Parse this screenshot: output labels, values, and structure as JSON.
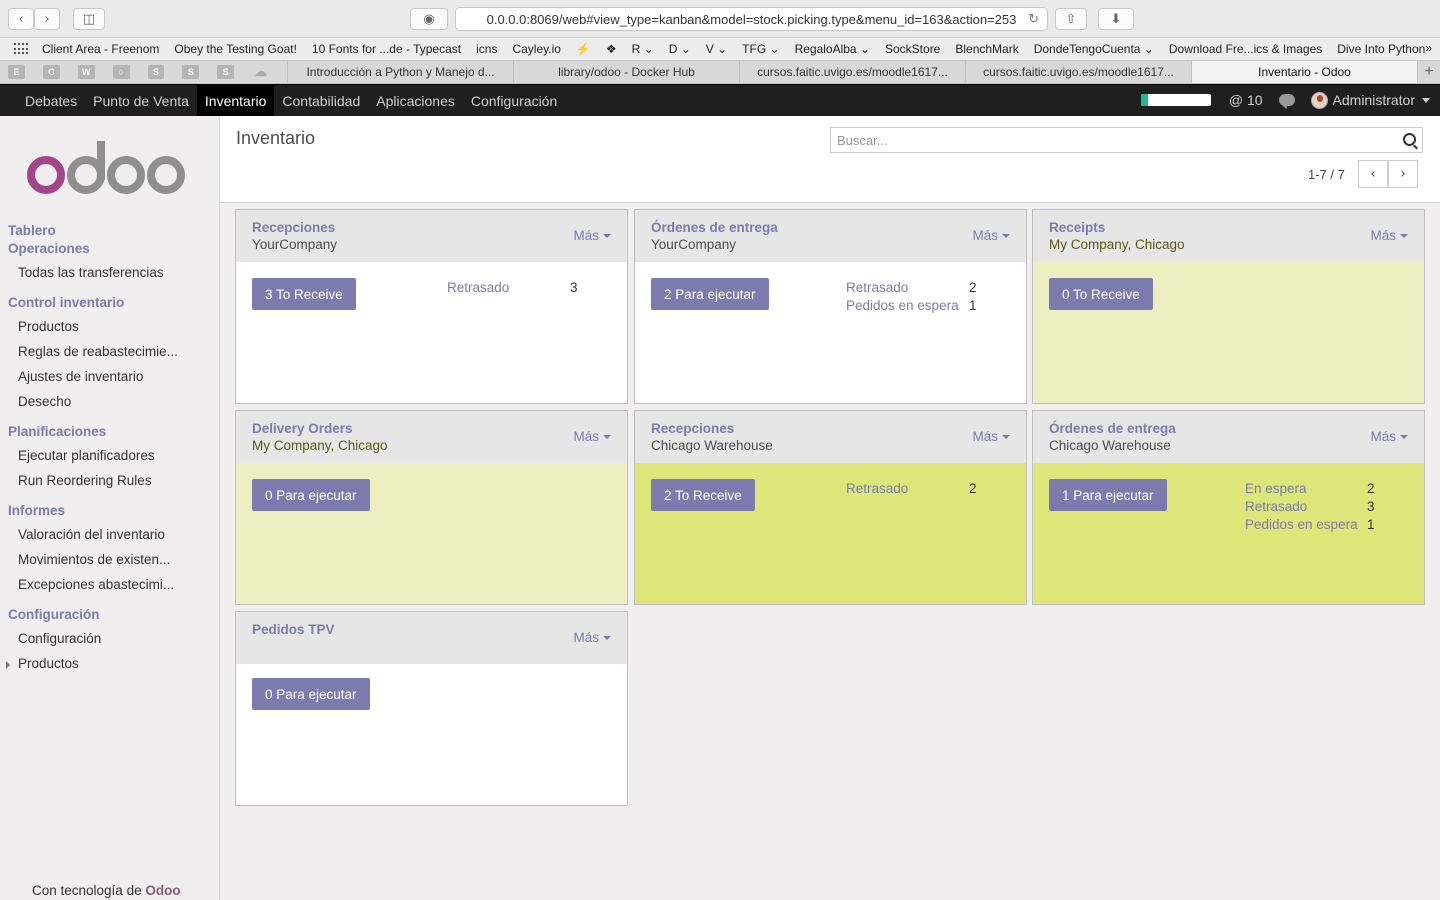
{
  "browser": {
    "url": "0.0.0.0:8069/web#view_type=kanban&model=stock.picking.type&menu_id=163&action=253",
    "bookmarks": [
      "Client Area - Freenom",
      "Obey the Testing Goat!",
      "10 Fonts for ...de - Typecast",
      "icns",
      "Cayley.io",
      "⚡",
      "❖",
      "R ⌄",
      "D ⌄",
      "V ⌄",
      "TFG ⌄",
      "RegaloAlba ⌄",
      "SockStore",
      "BlenchMark",
      "DondeTengoCuenta ⌄",
      "Download Fre...ics & Images",
      "Dive Into Python"
    ],
    "bookmarks_more": "»",
    "pinned_tabs": [
      "E",
      "C",
      "W",
      "○",
      "S",
      "S",
      "S",
      "☁"
    ],
    "tabs": [
      "Introducción a Python y Manejo d...",
      "library/odoo - Docker Hub",
      "cursos.faitic.uvigo.es/moodle1617...",
      "cursos.faitic.uvigo.es/moodle1617...",
      "Inventario - Odoo"
    ],
    "new_tab": "+"
  },
  "nav": {
    "items": [
      "Debates",
      "Punto de Venta",
      "Inventario",
      "Contabilidad",
      "Aplicaciones",
      "Configuración"
    ],
    "active_index": 2,
    "progress": 0.1,
    "mentions": "@ 10",
    "user": "Administrator"
  },
  "sidebar": {
    "logo": "odoo",
    "groups": [
      {
        "title": "Tablero",
        "items": []
      },
      {
        "title": "Operaciones",
        "items": [
          "Todas las transferencias"
        ]
      },
      {
        "title": "Control inventario",
        "items": [
          "Productos",
          "Reglas de reabastecimie...",
          "Ajustes de inventario",
          "Desecho"
        ]
      },
      {
        "title": "Planificaciones",
        "items": [
          "Ejecutar planificadores",
          "Run Reordering Rules"
        ]
      },
      {
        "title": "Informes",
        "items": [
          "Valoración del inventario",
          "Movimientos de existen...",
          "Excepciones abastecimi..."
        ]
      },
      {
        "title": "Configuración",
        "items": [
          "Configuración",
          "Productos"
        ]
      }
    ],
    "powered_prefix": "Con tecnología de ",
    "powered_brand": "Odoo"
  },
  "main": {
    "title": "Inventario",
    "search_placeholder": "Buscar...",
    "pager": "1-7 / 7",
    "more_label": "Más",
    "cards": [
      {
        "title": "Recepciones",
        "subtitle": "YourCompany",
        "button": "3 To Receive",
        "stats": [
          [
            "Retrasado",
            "3"
          ]
        ]
      },
      {
        "title": "Órdenes de entrega",
        "subtitle": "YourCompany",
        "button": "2 Para ejecutar",
        "stats": [
          [
            "Retrasado",
            "2"
          ],
          [
            "Pedidos en espera",
            "1"
          ]
        ]
      },
      {
        "title": "Receipts",
        "subtitle": "My Company, Chicago",
        "button": "0 To Receive",
        "stats": []
      },
      {
        "title": "Delivery Orders",
        "subtitle": "My Company, Chicago",
        "button": "0 Para ejecutar",
        "stats": []
      },
      {
        "title": "Recepciones",
        "subtitle": "Chicago Warehouse",
        "button": "2 To Receive",
        "stats": [
          [
            "Retrasado",
            "2"
          ]
        ]
      },
      {
        "title": "Órdenes de entrega",
        "subtitle": "Chicago Warehouse",
        "button": "1 Para ejecutar",
        "stats": [
          [
            "En espera",
            "2"
          ],
          [
            "Retrasado",
            "3"
          ],
          [
            "Pedidos en espera",
            "1"
          ]
        ]
      },
      {
        "title": "Pedidos TPV",
        "subtitle": "",
        "button": "0 Para ejecutar",
        "stats": []
      }
    ]
  },
  "colors": {
    "primary": "#7c7bad",
    "brand": "#875a7b",
    "card_light": "#ecefc1",
    "card_green": "#dde779",
    "progress": "#21b799"
  }
}
